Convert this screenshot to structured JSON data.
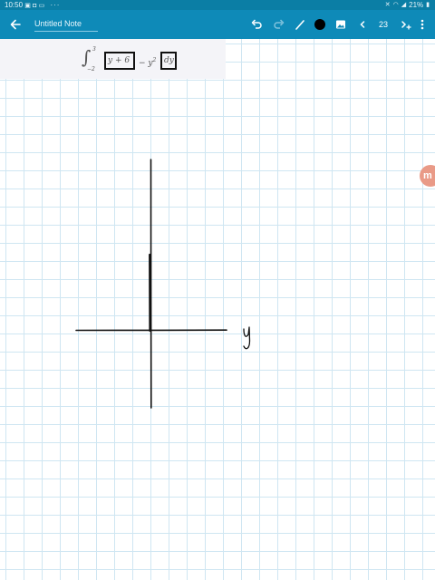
{
  "status_bar": {
    "time": "10:50",
    "icons_more": "···",
    "battery": "21%",
    "left_icons": [
      "image-icon",
      "message-icon",
      "sms-icon",
      "download-icon"
    ],
    "right_icons": [
      "mute-icon",
      "wifi-icon",
      "signal-icon",
      "battery-icon"
    ]
  },
  "app_bar": {
    "background": "#0e8ab8",
    "title": "Untitled Note",
    "page_number": "23",
    "pen_color": "#000000",
    "icons": [
      "back-arrow-icon",
      "undo-icon",
      "redo-icon",
      "pen-icon",
      "color-swatch-icon",
      "image-insert-icon",
      "previous-page-icon",
      "next-page-icon",
      "more-vert-icon"
    ]
  },
  "formula": {
    "integral_sign": "∫",
    "upper_limit": "3",
    "lower_limit": "−2",
    "boxed_term": "y + 6",
    "middle_term": "− y",
    "exponent": "2",
    "differential": "dy"
  },
  "side_badge": {
    "label": "m",
    "color": "#e99a87"
  },
  "drawing": {
    "axis_label": "y",
    "ink_color": "#111111",
    "grid_color": "#cfe6f2"
  }
}
